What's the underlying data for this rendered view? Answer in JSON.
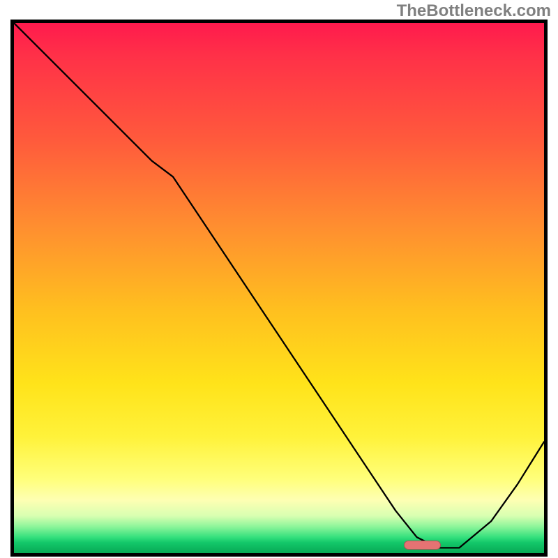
{
  "watermark": "TheBottleneck.com",
  "chart_data": {
    "type": "line",
    "title": "",
    "xlabel": "",
    "ylabel": "",
    "xlim": [
      0,
      100
    ],
    "ylim": [
      0,
      100
    ],
    "grid": false,
    "series": [
      {
        "name": "curve",
        "color": "#000000",
        "x": [
          0,
          8,
          16,
          22,
          26,
          30,
          40,
          50,
          60,
          68,
          72,
          76,
          80,
          84,
          90,
          95,
          100
        ],
        "y": [
          100,
          92,
          84,
          78,
          74,
          71,
          56,
          41,
          26,
          14,
          8,
          3,
          1,
          1,
          6,
          13,
          21
        ]
      }
    ],
    "marker": {
      "x_center": 77,
      "y": 1.5,
      "width_pct": 7,
      "height_pct": 1.8
    },
    "gradient_stops": [
      {
        "pct": 0,
        "color": "#ff1a4d"
      },
      {
        "pct": 22,
        "color": "#ff5a3c"
      },
      {
        "pct": 54,
        "color": "#ffbf1f"
      },
      {
        "pct": 78,
        "color": "#fff23a"
      },
      {
        "pct": 90,
        "color": "#feffb3"
      },
      {
        "pct": 97,
        "color": "#35e07d"
      },
      {
        "pct": 100,
        "color": "#09aa55"
      }
    ]
  }
}
